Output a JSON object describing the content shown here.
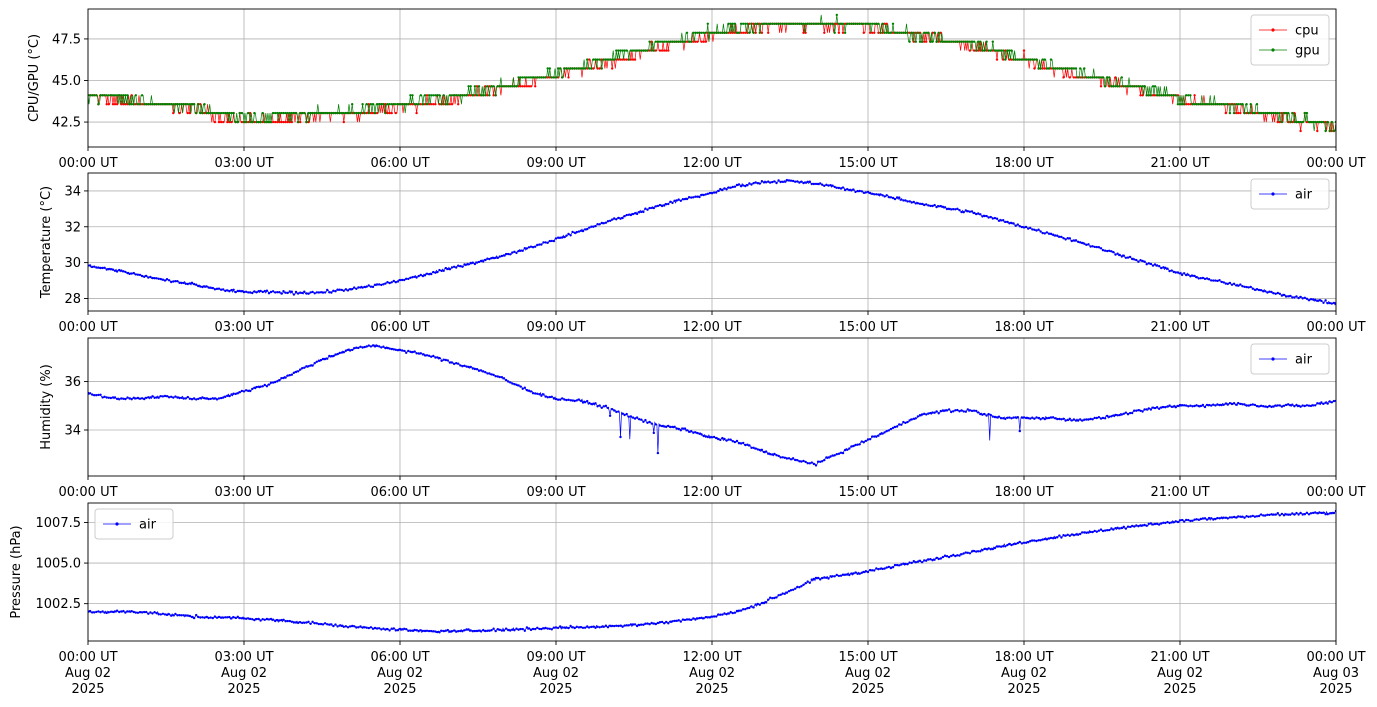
{
  "chart_data": [
    {
      "type": "line",
      "ylabel": "CPU/GPU (°C)",
      "xlabel": "",
      "xlim": [
        0,
        24
      ],
      "ylim": [
        41.0,
        49.3
      ],
      "yticks": [
        "42.5",
        "45.0",
        "47.5"
      ],
      "ytick_values": [
        42.5,
        45.0,
        47.5
      ],
      "legend_position": "upper right",
      "grid": true,
      "series": [
        {
          "name": "cpu",
          "color": "#ff0000",
          "quantization": 0.537,
          "x": [
            0,
            1,
            2,
            2.5,
            3,
            4,
            5,
            6,
            7,
            8,
            9,
            10,
            11,
            12,
            13,
            14,
            15,
            16,
            17,
            18,
            19,
            20,
            21,
            22,
            23,
            24
          ],
          "y": [
            44.0,
            43.7,
            43.3,
            42.9,
            42.5,
            42.7,
            43.0,
            43.4,
            43.9,
            44.6,
            45.3,
            46.1,
            47.0,
            47.7,
            48.3,
            48.3,
            48.2,
            47.7,
            47.0,
            46.2,
            45.3,
            44.6,
            43.9,
            43.4,
            42.7,
            42.2
          ]
        },
        {
          "name": "gpu",
          "color": "#008000",
          "quantization": 0.537,
          "x": [
            0,
            1,
            2,
            2.5,
            3,
            4,
            5,
            6,
            7,
            8,
            9,
            10,
            11,
            12,
            13,
            14,
            15,
            16,
            17,
            18,
            19,
            20,
            21,
            22,
            23,
            24
          ],
          "y": [
            44.0,
            43.8,
            43.4,
            43.0,
            42.8,
            42.9,
            43.2,
            43.6,
            44.0,
            44.7,
            45.4,
            46.3,
            47.2,
            47.9,
            48.4,
            48.4,
            48.3,
            47.8,
            47.2,
            46.3,
            45.5,
            44.8,
            44.0,
            43.5,
            42.8,
            42.3
          ]
        }
      ]
    },
    {
      "type": "line",
      "ylabel": "Temperature (°C)",
      "xlabel": "",
      "xlim": [
        0,
        24
      ],
      "ylim": [
        27.3,
        35.0
      ],
      "yticks": [
        "28",
        "30",
        "32",
        "34"
      ],
      "ytick_values": [
        28,
        30,
        32,
        34
      ],
      "legend_position": "upper right",
      "grid": true,
      "series": [
        {
          "name": "air",
          "color": "#0000ff",
          "x": [
            0,
            0.5,
            1,
            1.5,
            2,
            2.5,
            3,
            3.5,
            4,
            4.5,
            5,
            5.5,
            6,
            7,
            8,
            9,
            10,
            11,
            12,
            12.5,
            13,
            13.5,
            14,
            15,
            16,
            17,
            18,
            19,
            20,
            21,
            22,
            23,
            24
          ],
          "y": [
            29.8,
            29.6,
            29.3,
            29.0,
            28.8,
            28.5,
            28.35,
            28.35,
            28.3,
            28.35,
            28.5,
            28.7,
            29.0,
            29.7,
            30.4,
            31.3,
            32.3,
            33.2,
            33.9,
            34.3,
            34.5,
            34.55,
            34.4,
            33.9,
            33.3,
            32.8,
            32.0,
            31.2,
            30.3,
            29.4,
            28.8,
            28.2,
            27.7
          ]
        }
      ]
    },
    {
      "type": "line",
      "ylabel": "Humidity (%)",
      "xlabel": "",
      "xlim": [
        0,
        24
      ],
      "ylim": [
        32.1,
        37.8
      ],
      "yticks": [
        "34",
        "36"
      ],
      "ytick_values": [
        34,
        36
      ],
      "legend_position": "upper right",
      "grid": true,
      "series": [
        {
          "name": "air",
          "color": "#0000ff",
          "x": [
            0,
            0.5,
            1,
            1.5,
            2,
            2.5,
            3,
            3.5,
            4,
            4.5,
            5,
            5.5,
            6,
            6.5,
            7,
            7.5,
            8,
            8.5,
            9,
            9.5,
            10,
            10.5,
            11,
            11.5,
            12,
            12.5,
            13,
            13.5,
            14,
            14.5,
            15,
            15.5,
            16,
            16.5,
            17,
            17.5,
            18,
            18.5,
            19,
            19.5,
            20,
            20.5,
            21,
            21.5,
            22,
            22.5,
            23,
            23.5,
            24
          ],
          "y": [
            35.5,
            35.3,
            35.3,
            35.4,
            35.3,
            35.3,
            35.6,
            35.9,
            36.4,
            36.9,
            37.3,
            37.5,
            37.3,
            37.1,
            36.8,
            36.5,
            36.1,
            35.6,
            35.3,
            35.2,
            34.9,
            34.5,
            34.2,
            34.0,
            33.7,
            33.5,
            33.1,
            32.8,
            32.6,
            33.1,
            33.6,
            34.1,
            34.6,
            34.8,
            34.8,
            34.5,
            34.5,
            34.5,
            34.4,
            34.5,
            34.7,
            34.9,
            35.0,
            35.0,
            35.1,
            35.0,
            35.0,
            35.0,
            35.2
          ]
        }
      ]
    },
    {
      "type": "line",
      "ylabel": "Pressure (hPa)",
      "xlabel": "",
      "xlim": [
        0,
        24
      ],
      "ylim": [
        1000.2,
        1008.7
      ],
      "yticks": [
        "1002.5",
        "1005.0",
        "1007.5"
      ],
      "ytick_values": [
        1002.5,
        1005.0,
        1007.5
      ],
      "legend_position": "upper left",
      "grid": true,
      "series": [
        {
          "name": "air",
          "color": "#0000ff",
          "x": [
            0,
            1,
            2,
            3,
            4,
            5,
            6,
            6.5,
            7,
            8,
            9,
            10,
            11,
            12,
            12.5,
            13,
            13.5,
            14,
            15,
            16,
            17,
            18,
            19,
            20,
            21,
            22,
            23,
            24
          ],
          "y": [
            1002.0,
            1002.0,
            1001.7,
            1001.6,
            1001.4,
            1001.1,
            1000.9,
            1000.8,
            1000.8,
            1000.9,
            1001.0,
            1001.1,
            1001.3,
            1001.7,
            1002.0,
            1002.6,
            1003.3,
            1004.0,
            1004.5,
            1005.1,
            1005.7,
            1006.3,
            1006.8,
            1007.2,
            1007.6,
            1007.8,
            1008.0,
            1008.1
          ]
        }
      ]
    }
  ],
  "x_axis": {
    "ticks": [
      0,
      3,
      6,
      9,
      12,
      15,
      18,
      21,
      24
    ],
    "labels": [
      "00:00 UT",
      "03:00 UT",
      "06:00 UT",
      "09:00 UT",
      "12:00 UT",
      "15:00 UT",
      "18:00 UT",
      "21:00 UT",
      "00:00 UT"
    ],
    "date_lines": [
      "Aug 02",
      "Aug 02",
      "Aug 02",
      "Aug 02",
      "Aug 02",
      "Aug 02",
      "Aug 02",
      "Aug 02",
      "Aug 03"
    ],
    "year_lines": [
      "2025",
      "2025",
      "2025",
      "2025",
      "2025",
      "2025",
      "2025",
      "2025",
      "2025"
    ]
  }
}
